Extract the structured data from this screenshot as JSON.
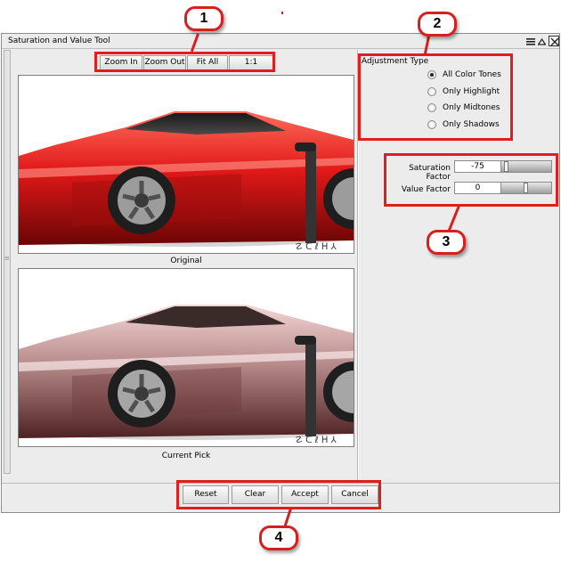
{
  "window": {
    "title": "Saturation and Value Tool"
  },
  "zoom_toolbar": {
    "zoom_in": "Zoom In",
    "zoom_out": "Zoom Out",
    "fit_all": "Fit All",
    "one_to_one": "1:1"
  },
  "images": {
    "original_caption": "Original",
    "current_caption": "Current Pick"
  },
  "adjustment": {
    "heading": "Adjustment Type",
    "options": [
      "All Color Tones",
      "Only Highlight",
      "Only Midtones",
      "Only Shadows"
    ],
    "selected": "All Color Tones"
  },
  "factors": {
    "saturation_label": "Saturation Factor",
    "saturation_value": "-75",
    "saturation_level": -75,
    "value_label": "Value Factor",
    "value_value": "0",
    "value_level": 0
  },
  "actions": {
    "reset": "Reset",
    "clear": "Clear",
    "accept": "Accept",
    "cancel": "Cancel"
  },
  "callouts": [
    "1",
    "2",
    "3",
    "4"
  ],
  "colors": {
    "callout_red": "#d81e1e",
    "car_original": "#e01818",
    "car_desaturated": "#b78a8a"
  }
}
